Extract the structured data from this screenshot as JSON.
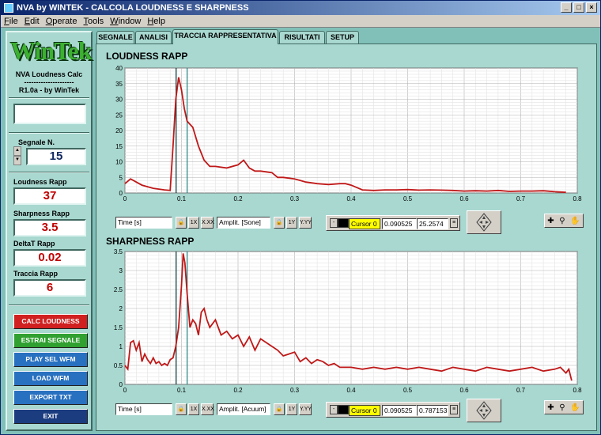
{
  "window": {
    "title": "NVA by WINTEK - CALCOLA LOUDNESS E SHARPNESS",
    "controls": [
      "_",
      "□",
      "×"
    ]
  },
  "menu": {
    "items": [
      {
        "underline": "F",
        "rest": "ile"
      },
      {
        "underline": "E",
        "rest": "dit"
      },
      {
        "underline": "O",
        "rest": "perate"
      },
      {
        "underline": "T",
        "rest": "ools"
      },
      {
        "underline": "W",
        "rest": "indow"
      },
      {
        "underline": "H",
        "rest": "elp"
      }
    ]
  },
  "left": {
    "logo": "WinTek",
    "app_name": "NVA Loudness Calc",
    "dashes": "---------------------",
    "version": "R1.0a - by WinTek",
    "blank_field": "",
    "segnale_label": "Segnale N.",
    "segnale_value": "15",
    "loudness_label": "Loudness Rapp",
    "loudness_value": "37",
    "sharpness_label": "Sharpness Rapp",
    "sharpness_value": "3.5",
    "deltat_label": "DeltaT Rapp",
    "deltat_value": "0.02",
    "traccia_label": "Traccia Rapp",
    "traccia_value": "6",
    "buttons": [
      {
        "label": "CALC LOUDNESS",
        "color": "#d02020"
      },
      {
        "label": "ESTRAI SEGNALE",
        "color": "#30a030"
      },
      {
        "label": "PLAY SEL WFM",
        "color": "#2870c0"
      },
      {
        "label": "LOAD WFM",
        "color": "#2870c0"
      },
      {
        "label": "EXPORT TXT",
        "color": "#2870c0"
      },
      {
        "label": "EXIT",
        "color": "#1c3c80"
      }
    ]
  },
  "tabs": [
    {
      "label": "SEGNALE",
      "active": false
    },
    {
      "label": "ANALISI",
      "active": false
    },
    {
      "label": "TRACCIA RAPPRESENTATIVA",
      "active": true
    },
    {
      "label": "RISULTATI",
      "active": false
    },
    {
      "label": "SETUP",
      "active": false
    }
  ],
  "loudness_graph": {
    "title": "LOUDNESS RAPP",
    "x_field": "Time [s]",
    "y_field": "Amplit. [Sone]",
    "cursor_name": "Cursor 0",
    "cursor_x": "0.090525",
    "cursor_y": "25.2574"
  },
  "sharpness_graph": {
    "title": "SHARPNESS RAPP",
    "x_field": "Time [s]",
    "y_field": "Amplit. [Acuum]",
    "cursor_name": "Cursor 0",
    "cursor_x": "0.090525",
    "cursor_y": "0.787153"
  },
  "scale_button_labels": {
    "lock": "🔒",
    "x_scale": "1X",
    "x_format": "X.XX",
    "y_scale": "1Y",
    "y_format": "Y.YY"
  },
  "chart_data": [
    {
      "type": "line",
      "title": "LOUDNESS RAPP",
      "xlabel": "Time [s]",
      "ylabel": "Amplit. [Sone]",
      "xlim": [
        0,
        0.8
      ],
      "ylim": [
        0,
        40
      ],
      "x_ticks": [
        "0",
        "0.1",
        "0.2",
        "0.3",
        "0.4",
        "0.5",
        "0.6",
        "0.7",
        "0.8"
      ],
      "y_ticks": [
        "0",
        "5",
        "10",
        "15",
        "20",
        "25",
        "30",
        "35",
        "40"
      ],
      "grid": true,
      "color": "#c01818",
      "cursor_lines_x": [
        0.090525,
        0.11
      ],
      "x": [
        0,
        0.01,
        0.03,
        0.05,
        0.07,
        0.08,
        0.085,
        0.09,
        0.095,
        0.1,
        0.105,
        0.11,
        0.12,
        0.13,
        0.14,
        0.15,
        0.16,
        0.18,
        0.2,
        0.21,
        0.22,
        0.23,
        0.24,
        0.26,
        0.27,
        0.28,
        0.3,
        0.32,
        0.34,
        0.36,
        0.38,
        0.39,
        0.4,
        0.42,
        0.44,
        0.46,
        0.48,
        0.5,
        0.52,
        0.54,
        0.56,
        0.58,
        0.6,
        0.62,
        0.64,
        0.66,
        0.68,
        0.7,
        0.72,
        0.74,
        0.76,
        0.78
      ],
      "y": [
        3,
        4.5,
        2.5,
        1.5,
        1.0,
        0.8,
        15,
        30,
        37,
        33,
        27,
        23,
        21,
        15,
        10.5,
        8.5,
        8.5,
        8,
        9,
        10.5,
        8,
        7,
        7,
        6.5,
        5,
        5,
        4.5,
        3.5,
        3,
        2.7,
        3,
        3,
        2.5,
        1,
        0.8,
        1,
        1,
        1.1,
        0.9,
        1,
        0.9,
        0.8,
        0.6,
        0.7,
        0.6,
        0.8,
        0.5,
        0.6,
        0.6,
        0.7,
        0.4,
        0.2
      ]
    },
    {
      "type": "line",
      "title": "SHARPNESS RAPP",
      "xlabel": "Time [s]",
      "ylabel": "Amplit. [Acuum]",
      "xlim": [
        0,
        0.8
      ],
      "ylim": [
        0,
        3.5
      ],
      "x_ticks": [
        "0",
        "0.1",
        "0.2",
        "0.3",
        "0.4",
        "0.5",
        "0.6",
        "0.7",
        "0.8"
      ],
      "y_ticks": [
        "0",
        "0.5",
        "1",
        "1.5",
        "2",
        "2.5",
        "3",
        "3.5"
      ],
      "grid": true,
      "color": "#c01818",
      "cursor_lines_x": [
        0.090525,
        0.11
      ],
      "x": [
        0,
        0.005,
        0.01,
        0.015,
        0.02,
        0.025,
        0.03,
        0.035,
        0.04,
        0.045,
        0.05,
        0.055,
        0.06,
        0.065,
        0.07,
        0.075,
        0.08,
        0.085,
        0.09,
        0.095,
        0.1,
        0.103,
        0.106,
        0.11,
        0.115,
        0.12,
        0.125,
        0.13,
        0.135,
        0.14,
        0.145,
        0.15,
        0.16,
        0.17,
        0.18,
        0.19,
        0.2,
        0.21,
        0.22,
        0.23,
        0.24,
        0.25,
        0.26,
        0.27,
        0.28,
        0.29,
        0.3,
        0.31,
        0.32,
        0.33,
        0.34,
        0.35,
        0.36,
        0.37,
        0.38,
        0.4,
        0.42,
        0.44,
        0.46,
        0.48,
        0.5,
        0.52,
        0.54,
        0.56,
        0.58,
        0.6,
        0.62,
        0.64,
        0.66,
        0.68,
        0.7,
        0.72,
        0.74,
        0.76,
        0.77,
        0.78,
        0.785,
        0.79
      ],
      "y": [
        0.5,
        0.4,
        1.1,
        1.15,
        0.9,
        1.1,
        0.6,
        0.8,
        0.65,
        0.55,
        0.7,
        0.55,
        0.6,
        0.5,
        0.55,
        0.5,
        0.65,
        0.7,
        1.0,
        1.5,
        2.6,
        3.45,
        3.2,
        2.4,
        1.5,
        1.7,
        1.6,
        1.3,
        1.9,
        2.0,
        1.7,
        1.5,
        1.7,
        1.3,
        1.4,
        1.2,
        1.3,
        1.0,
        1.25,
        0.9,
        1.2,
        1.1,
        1.0,
        0.9,
        0.75,
        0.8,
        0.85,
        0.6,
        0.7,
        0.55,
        0.65,
        0.6,
        0.5,
        0.55,
        0.45,
        0.45,
        0.4,
        0.45,
        0.4,
        0.45,
        0.4,
        0.45,
        0.4,
        0.35,
        0.45,
        0.4,
        0.35,
        0.45,
        0.4,
        0.35,
        0.4,
        0.45,
        0.35,
        0.4,
        0.45,
        0.3,
        0.4,
        0.1
      ]
    }
  ]
}
